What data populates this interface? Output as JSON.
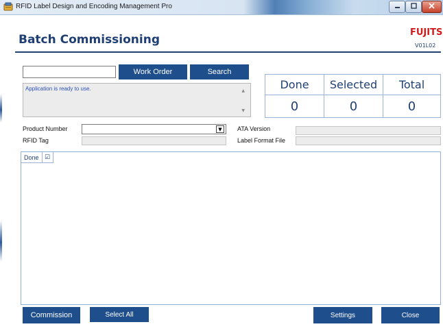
{
  "window": {
    "title": "RFID Label Design and Encoding Management Pro"
  },
  "header": {
    "title": "Batch Commissioning",
    "brand": "FUJITSU",
    "version": "V01L02"
  },
  "search": {
    "work_order_value": "",
    "work_order_label": "Work Order",
    "search_label": "Search"
  },
  "status": {
    "message": "Application is ready to use."
  },
  "counters": {
    "done_label": "Done",
    "done_value": "0",
    "selected_label": "Selected",
    "selected_value": "0",
    "total_label": "Total",
    "total_value": "0"
  },
  "fields": {
    "product_number_label": "Product Number",
    "product_number_value": "",
    "rfid_tag_label": "RFID Tag",
    "ata_version_label": "ATA Version",
    "label_format_file_label": "Label Format File"
  },
  "grid": {
    "columns": [
      "Done",
      "☑"
    ],
    "rows": []
  },
  "footer": {
    "commission_label": "Commission",
    "select_all_label": "Select All",
    "settings_label": "Settings",
    "close_label": "Close"
  },
  "colors": {
    "accent": "#1f4e8c",
    "title_text": "#1f3f74",
    "brand_red": "#d21a1a",
    "status_text": "#2b50b8"
  },
  "icons": {
    "app": "rfid-app-icon",
    "minimize": "minimize-icon",
    "maximize": "maximize-icon",
    "close": "close-icon",
    "dropdown": "chevron-down-icon"
  }
}
